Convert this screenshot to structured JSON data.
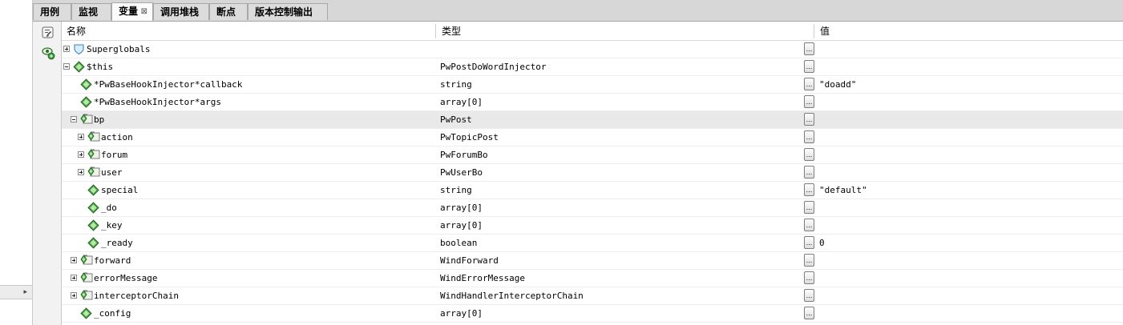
{
  "tabs": [
    {
      "label": "用例"
    },
    {
      "label": "监视"
    },
    {
      "label": "变量",
      "close": "⊠"
    },
    {
      "label": "调用堆栈"
    },
    {
      "label": "断点"
    },
    {
      "label": "版本控制输出"
    }
  ],
  "toolbar": {
    "icons": [
      "variables-settings-icon",
      "new-watch-icon"
    ]
  },
  "columns": {
    "name": "名称",
    "type": "类型",
    "value": "值"
  },
  "value_button_label": "...",
  "rows": [
    {
      "name": "Superglobals",
      "type": "",
      "value": "",
      "level": 0,
      "expander": "plus",
      "icon": "shield"
    },
    {
      "name": "$this",
      "type": "PwPostDoWordInjector",
      "value": "",
      "level": 0,
      "expander": "minus",
      "icon": "green"
    },
    {
      "name": "*PwBaseHookInjector*callback",
      "type": "string",
      "value": "\"doadd\"",
      "level": 1,
      "expander": "",
      "icon": "green"
    },
    {
      "name": "*PwBaseHookInjector*args",
      "type": "array[0]",
      "value": "",
      "level": 1,
      "expander": "",
      "icon": "green"
    },
    {
      "name": "bp",
      "type": "PwPost",
      "value": "",
      "level": 1,
      "expander": "minus",
      "icon": "object",
      "selected": true
    },
    {
      "name": "action",
      "type": "PwTopicPost",
      "value": "",
      "level": 2,
      "expander": "plus",
      "icon": "object"
    },
    {
      "name": "forum",
      "type": "PwForumBo",
      "value": "",
      "level": 2,
      "expander": "plus",
      "icon": "object"
    },
    {
      "name": "user",
      "type": "PwUserBo",
      "value": "",
      "level": 2,
      "expander": "plus",
      "icon": "object"
    },
    {
      "name": "special",
      "type": "string",
      "value": "\"default\"",
      "level": 2,
      "expander": "",
      "icon": "green"
    },
    {
      "name": "_do",
      "type": "array[0]",
      "value": "",
      "level": 2,
      "expander": "",
      "icon": "green"
    },
    {
      "name": "_key",
      "type": "array[0]",
      "value": "",
      "level": 2,
      "expander": "",
      "icon": "green"
    },
    {
      "name": "_ready",
      "type": "boolean",
      "value": "0",
      "level": 2,
      "expander": "",
      "icon": "green"
    },
    {
      "name": "forward",
      "type": "WindForward",
      "value": "",
      "level": 1,
      "expander": "plus",
      "icon": "object"
    },
    {
      "name": "errorMessage",
      "type": "WindErrorMessage",
      "value": "",
      "level": 1,
      "expander": "plus",
      "icon": "object"
    },
    {
      "name": "interceptorChain",
      "type": "WindHandlerInterceptorChain",
      "value": "",
      "level": 1,
      "expander": "plus",
      "icon": "object"
    },
    {
      "name": "_config",
      "type": "array[0]",
      "value": "",
      "level": 1,
      "expander": "",
      "icon": "green"
    }
  ],
  "left_scroll_arrow": "▸"
}
